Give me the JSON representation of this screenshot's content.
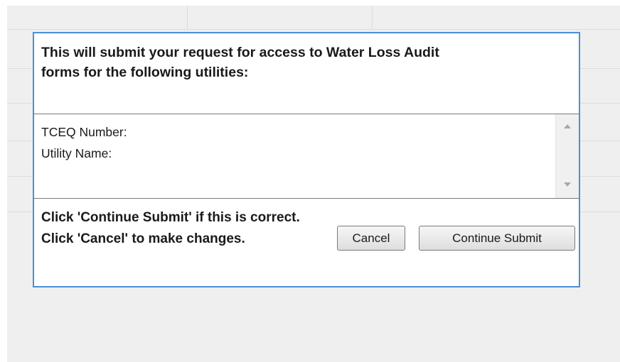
{
  "dialog": {
    "header_line1": "This will submit your request for access to Water Loss Audit",
    "header_line2": "forms for the following utilities:",
    "list": {
      "tceq_label": "TCEQ Number:",
      "utility_label": "Utility Name:"
    },
    "footer_line1": "Click 'Continue Submit' if this is correct.",
    "footer_line2": "Click 'Cancel' to make changes.",
    "cancel_label": "Cancel",
    "continue_label": "Continue Submit"
  },
  "icons": {
    "scroll_up": "scroll-up-arrow-icon",
    "scroll_down": "scroll-down-arrow-icon"
  },
  "colors": {
    "dialog_border": "#4a90d9",
    "background": "#efefef"
  }
}
